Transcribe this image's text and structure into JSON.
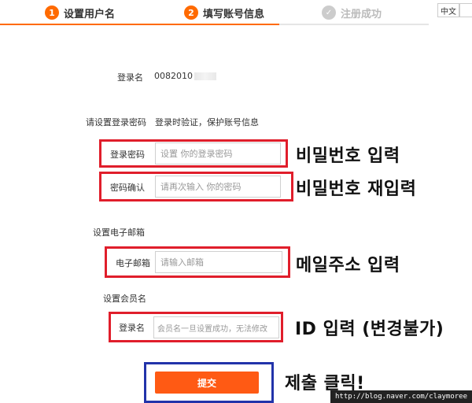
{
  "steps": [
    {
      "num": "1",
      "label": "设置用户名",
      "color": "#ff6a00"
    },
    {
      "num": "2",
      "label": "填写账号信息",
      "color": "#ff6a00"
    },
    {
      "label": "注册成功",
      "icon": "check-icon"
    }
  ],
  "lang": {
    "label": "中文"
  },
  "login_name": {
    "label": "登录名",
    "value": "0082010"
  },
  "password_section": {
    "label": "请设置登录密码",
    "hint": "登录时验证，保护账号信息"
  },
  "password": {
    "label": "登录密码",
    "placeholder": "设置 你的登录密码"
  },
  "confirm": {
    "label": "密码确认",
    "placeholder": "请再次输入 你的密码"
  },
  "email_section": {
    "label": "设置电子邮箱"
  },
  "email": {
    "label": "电子邮箱",
    "placeholder": "请输入邮箱"
  },
  "member_section": {
    "label": "设置会员名"
  },
  "member": {
    "label": "登录名",
    "placeholder": "会员名一旦设置成功，无法修改"
  },
  "submit": {
    "label": "提交"
  },
  "annotations": {
    "password": "비밀번호 입력",
    "confirm": "비밀번호 재입력",
    "email": "메일주소 입력",
    "member": "ID 입력 (변경불가)",
    "submit": "제출 클릭!"
  },
  "watermark": "http://blog.naver.com/claymoree",
  "colors": {
    "accent": "#ff6a00",
    "highlight_red": "#e01e2b",
    "highlight_blue": "#2233aa",
    "submit": "#ff5a14"
  }
}
